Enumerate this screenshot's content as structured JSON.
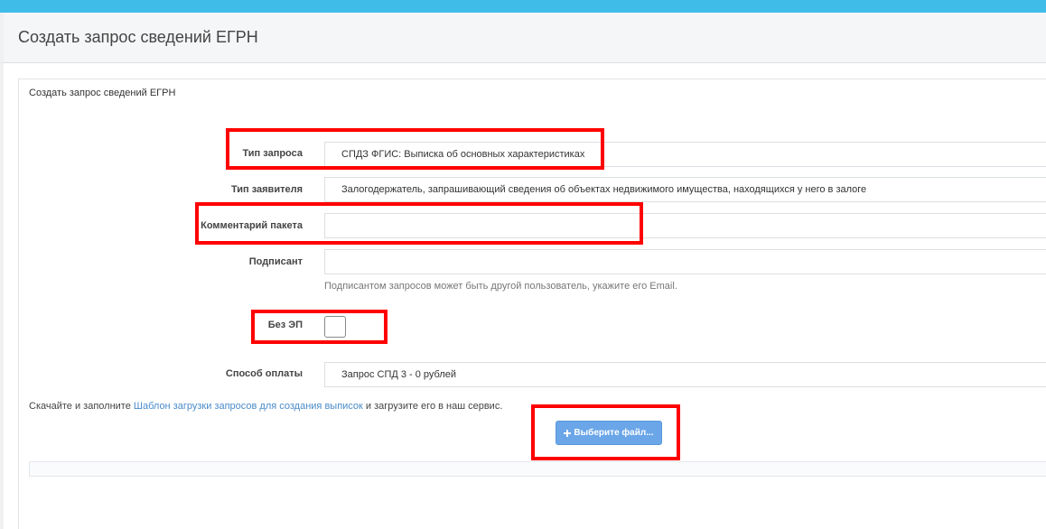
{
  "header": {
    "title": "Создать запрос сведений ЕГРН"
  },
  "panel": {
    "title": "Создать запрос сведений ЕГРН"
  },
  "form": {
    "request_type": {
      "label": "Тип запроса",
      "value": "СПДЗ ФГИС: Выписка об основных характеристиках"
    },
    "applicant_type": {
      "label": "Тип заявителя",
      "value": "Залогодержатель, запрашивающий сведения об объектах недвижимого имущества, находящихся у него в залоге"
    },
    "package_comment": {
      "label": "Комментарий пакета",
      "value": ""
    },
    "signer": {
      "label": "Подписант",
      "value": "",
      "help": "Подписантом запросов может быть другой пользователь, укажите его Email."
    },
    "no_ep": {
      "label": "Без ЭП",
      "checked": false
    },
    "payment_method": {
      "label": "Способ оплаты",
      "value": "Запрос СПД 3 - 0 рублей"
    }
  },
  "hint": {
    "before": "Скачайте и заполните ",
    "link": "Шаблон загрузки запросов для создания выписок",
    "after": " и загрузите его в наш сервис."
  },
  "upload": {
    "label": "Выберите файл...",
    "icon": "plus-icon"
  },
  "colors": {
    "topbar": "#3fbde8",
    "button": "#6aa6e8",
    "highlight": "#ff0000",
    "link": "#4a8bc9"
  }
}
